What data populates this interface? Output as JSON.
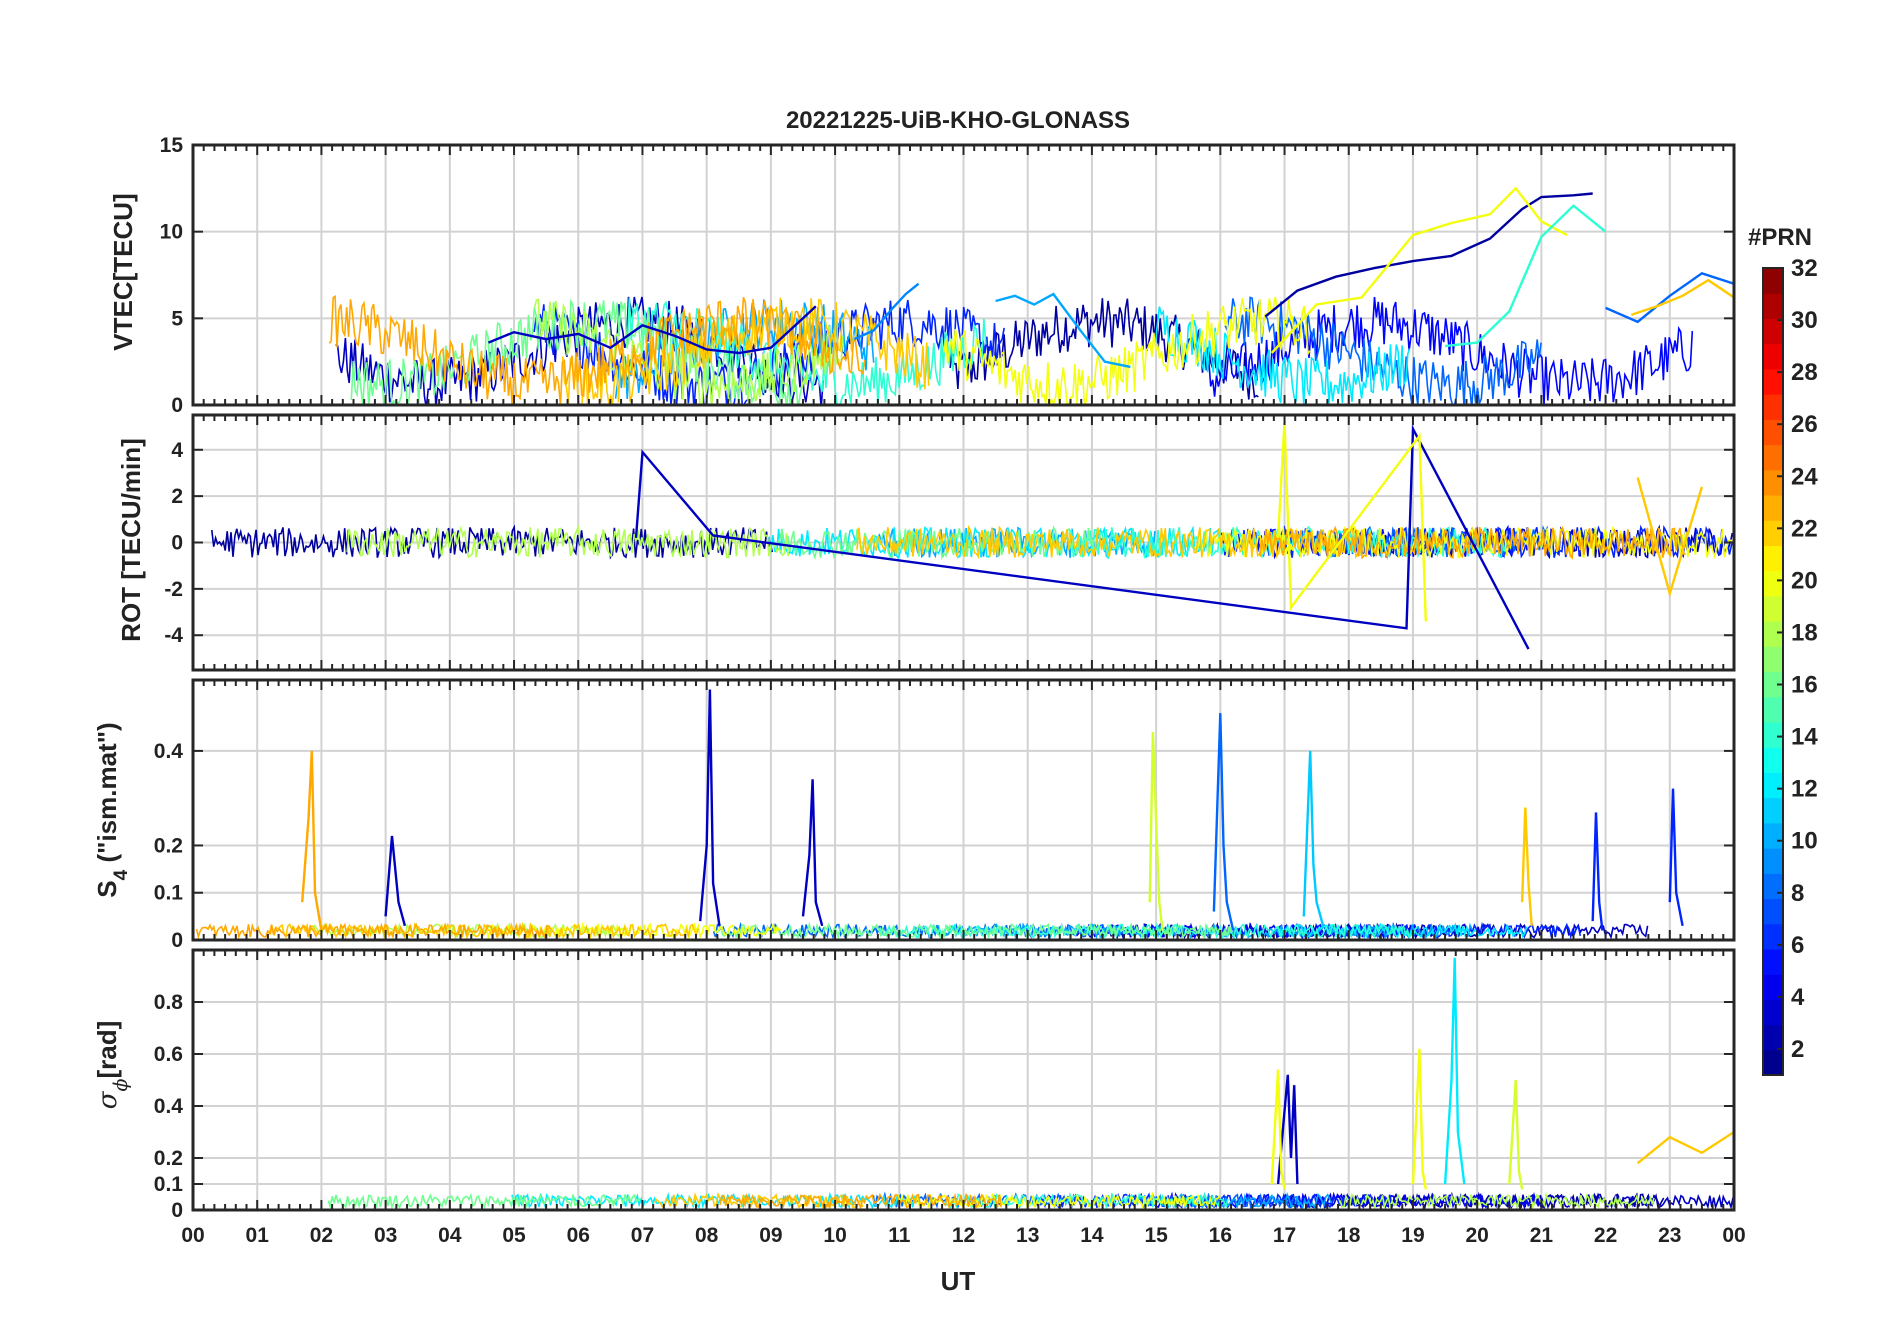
{
  "figure": {
    "title": "20221225-UiB-KHO-GLONASS",
    "xlabel": "UT",
    "x_ticks": [
      "00",
      "01",
      "02",
      "03",
      "04",
      "05",
      "06",
      "07",
      "08",
      "09",
      "10",
      "11",
      "12",
      "13",
      "14",
      "15",
      "16",
      "17",
      "18",
      "19",
      "20",
      "21",
      "22",
      "23",
      "00"
    ],
    "colorbar": {
      "label": "#PRN",
      "range": [
        1,
        32
      ],
      "ticks": [
        "2",
        "4",
        "6",
        "8",
        "10",
        "12",
        "14",
        "16",
        "18",
        "20",
        "22",
        "24",
        "26",
        "28",
        "30",
        "32"
      ],
      "colormap": "jet",
      "jet_stops": [
        "#00007f",
        "#0000ff",
        "#007fff",
        "#00ffff",
        "#7fff7f",
        "#ffff00",
        "#ff7f00",
        "#ff0000",
        "#7f0000"
      ]
    }
  },
  "chart_data": [
    {
      "type": "line",
      "panel": "VTEC",
      "ylabel": "VTEC[TECU]",
      "ylim": [
        0,
        15
      ],
      "yticks": [
        "0",
        "5",
        "10",
        "15"
      ],
      "xlim": [
        0,
        24
      ],
      "grid": true,
      "series": [
        {
          "prn": 3,
          "x": [
            4.6,
            5,
            5.5,
            6,
            6.5,
            7,
            7.5,
            8,
            8.5,
            9,
            9.5,
            9.7
          ],
          "values": [
            3.6,
            4.2,
            3.8,
            4.1,
            3.3,
            4.6,
            4.0,
            3.2,
            3.0,
            3.3,
            5.0,
            5.7
          ]
        },
        {
          "prn": 9,
          "x": [
            10.3,
            10.6,
            10.9,
            11.1,
            11.3
          ],
          "values": [
            3.8,
            4.3,
            5.6,
            6.4,
            7.0
          ]
        },
        {
          "prn": 10,
          "x": [
            12.5,
            12.8,
            13.1,
            13.4,
            13.8,
            14.2,
            14.6
          ],
          "values": [
            6.0,
            6.3,
            5.8,
            6.4,
            4.4,
            2.5,
            2.2
          ]
        },
        {
          "prn": 2,
          "x": [
            16.7,
            17.2,
            17.8,
            18.4,
            19,
            19.6,
            20.2,
            20.7,
            21,
            21.5,
            21.8
          ],
          "values": [
            5.1,
            6.6,
            7.4,
            7.9,
            8.3,
            8.6,
            9.6,
            11.3,
            12.0,
            12.1,
            12.2
          ]
        },
        {
          "prn": 20,
          "x": [
            16.8,
            17.5,
            18.2,
            19,
            19.6,
            20.2,
            20.6,
            21,
            21.4
          ],
          "values": [
            3.0,
            5.8,
            6.2,
            9.8,
            10.5,
            11.0,
            12.5,
            10.6,
            9.8
          ]
        },
        {
          "prn": 14,
          "x": [
            19.5,
            20,
            20.5,
            21,
            21.5,
            22
          ],
          "values": [
            3.4,
            3.6,
            5.4,
            9.7,
            11.5,
            10.0
          ]
        },
        {
          "prn": 8,
          "x": [
            22,
            22.5,
            23,
            23.5,
            24
          ],
          "values": [
            5.6,
            4.8,
            6.3,
            7.6,
            7.0
          ]
        },
        {
          "prn": 22,
          "x": [
            22.4,
            22.8,
            23.2,
            23.6,
            24
          ],
          "values": [
            5.2,
            5.7,
            6.3,
            7.2,
            6.2
          ]
        }
      ]
    },
    {
      "type": "line",
      "panel": "ROT",
      "ylabel": "ROT [TECU/min]",
      "ylim": [
        -5.5,
        5.5
      ],
      "yticks": [
        "-4",
        "-2",
        "0",
        "2",
        "4"
      ],
      "xlim": [
        0,
        24
      ],
      "grid": true,
      "series": [
        {
          "prn": 3,
          "x": [
            6.9,
            7.0,
            8.1,
            18.9,
            19.0,
            20.8
          ],
          "values": [
            0.2,
            3.9,
            0.3,
            -3.7,
            4.9,
            -4.6
          ]
        },
        {
          "prn": 20,
          "x": [
            16.9,
            17.0,
            17.1,
            19.1,
            19.2
          ],
          "values": [
            0.2,
            5.2,
            -2.8,
            4.6,
            -3.4
          ]
        },
        {
          "prn": 22,
          "x": [
            22.5,
            23.0,
            23.5
          ],
          "values": [
            2.8,
            -2.2,
            2.4
          ]
        }
      ]
    },
    {
      "type": "line",
      "panel": "S4",
      "ylabel": "S4 (\"ism.mat\")",
      "ylabel_main": "S",
      "ylabel_sub": "4",
      "ylabel_rest": " (\"ism.mat\")",
      "ylim": [
        0,
        0.55
      ],
      "yticks": [
        "0",
        "0.1",
        "0.2",
        "0.4"
      ],
      "xlim": [
        0,
        24
      ],
      "grid": true,
      "series": [
        {
          "prn": 23,
          "x": [
            1.7,
            1.8,
            1.85,
            1.9,
            2.0
          ],
          "values": [
            0.08,
            0.26,
            0.4,
            0.1,
            0.02
          ]
        },
        {
          "prn": 3,
          "x": [
            3.0,
            3.1,
            3.2,
            3.3
          ],
          "values": [
            0.05,
            0.22,
            0.08,
            0.03
          ]
        },
        {
          "prn": 3,
          "x": [
            7.9,
            8.0,
            8.05,
            8.1,
            8.2
          ],
          "values": [
            0.04,
            0.2,
            0.53,
            0.12,
            0.03
          ]
        },
        {
          "prn": 3,
          "x": [
            9.5,
            9.6,
            9.65,
            9.7,
            9.8
          ],
          "values": [
            0.05,
            0.18,
            0.34,
            0.08,
            0.03
          ]
        },
        {
          "prn": 19,
          "x": [
            14.9,
            14.95,
            15.0,
            15.05,
            15.1
          ],
          "values": [
            0.08,
            0.44,
            0.25,
            0.08,
            0.02
          ]
        },
        {
          "prn": 8,
          "x": [
            15.9,
            16.0,
            16.05,
            16.1,
            16.2
          ],
          "values": [
            0.06,
            0.48,
            0.2,
            0.08,
            0.02
          ]
        },
        {
          "prn": 11,
          "x": [
            17.3,
            17.4,
            17.45,
            17.5,
            17.6
          ],
          "values": [
            0.05,
            0.4,
            0.16,
            0.08,
            0.03
          ]
        },
        {
          "prn": 22,
          "x": [
            20.7,
            20.75,
            20.8,
            20.85
          ],
          "values": [
            0.08,
            0.28,
            0.12,
            0.03
          ]
        },
        {
          "prn": 6,
          "x": [
            21.8,
            21.85,
            21.9,
            21.95
          ],
          "values": [
            0.04,
            0.27,
            0.08,
            0.02
          ]
        },
        {
          "prn": 6,
          "x": [
            23.0,
            23.05,
            23.1,
            23.2
          ],
          "values": [
            0.08,
            0.32,
            0.1,
            0.03
          ]
        }
      ]
    },
    {
      "type": "line",
      "panel": "SigmaPhi",
      "ylabel": "σφ[rad]",
      "ylabel_main": "σ",
      "ylabel_sub": "ϕ",
      "ylabel_rest": "[rad]",
      "ylim": [
        0,
        1.0
      ],
      "yticks": [
        "0",
        "0.1",
        "0.2",
        "0.4",
        "0.6",
        "0.8"
      ],
      "xlim": [
        0,
        24
      ],
      "grid": true,
      "series": [
        {
          "prn": 3,
          "x": [
            16.9,
            17.0,
            17.05,
            17.1,
            17.15,
            17.2
          ],
          "values": [
            0.1,
            0.38,
            0.52,
            0.2,
            0.48,
            0.1
          ]
        },
        {
          "prn": 20,
          "x": [
            16.8,
            16.9,
            16.95,
            17.0
          ],
          "values": [
            0.1,
            0.54,
            0.15,
            0.08
          ]
        },
        {
          "prn": 20,
          "x": [
            19.0,
            19.1,
            19.15,
            19.2
          ],
          "values": [
            0.1,
            0.62,
            0.15,
            0.08
          ]
        },
        {
          "prn": 12,
          "x": [
            19.5,
            19.6,
            19.65,
            19.7,
            19.8
          ],
          "values": [
            0.1,
            0.5,
            0.97,
            0.3,
            0.1
          ]
        },
        {
          "prn": 19,
          "x": [
            20.5,
            20.6,
            20.65,
            20.7
          ],
          "values": [
            0.1,
            0.5,
            0.15,
            0.08
          ]
        },
        {
          "prn": 22,
          "x": [
            22.5,
            23.0,
            23.5,
            24.0
          ],
          "values": [
            0.18,
            0.28,
            0.22,
            0.3
          ]
        }
      ]
    }
  ]
}
